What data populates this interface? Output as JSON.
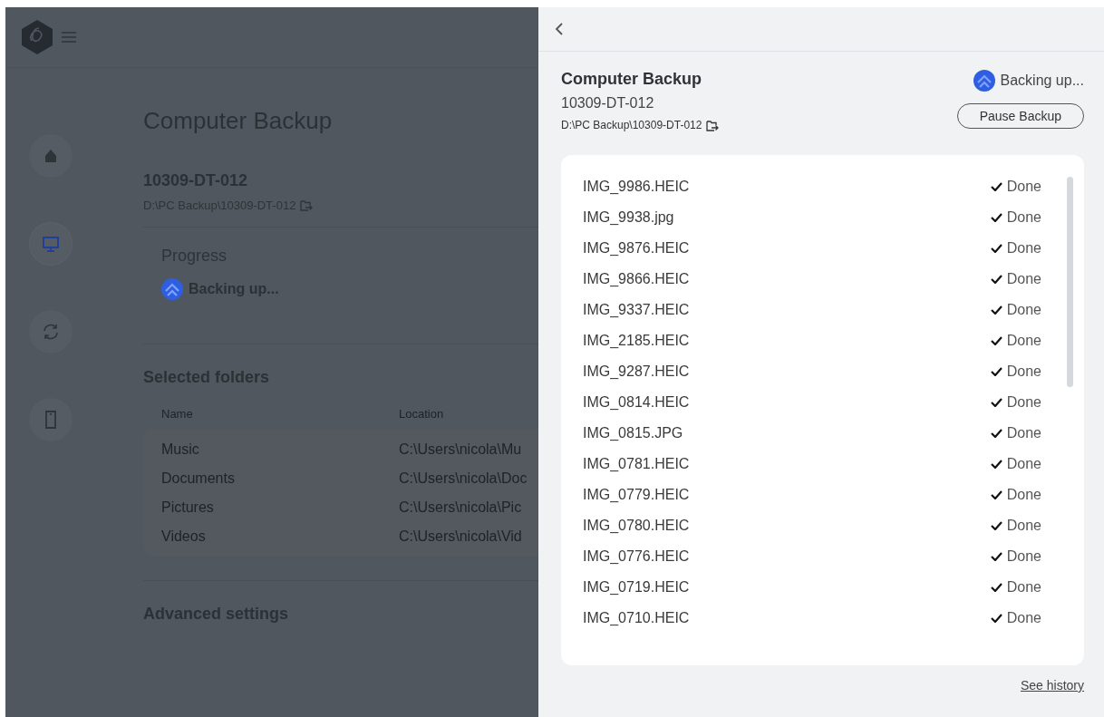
{
  "app": {
    "nav": [
      {
        "kind": "home",
        "selected": false
      },
      {
        "kind": "computer",
        "selected": true
      },
      {
        "kind": "sync",
        "selected": false
      },
      {
        "kind": "phone",
        "selected": false
      }
    ],
    "title": "Computer Backup",
    "device": "10309-DT-012",
    "path": "D:\\PC Backup\\10309-DT-012",
    "progress": {
      "heading": "Progress",
      "status": "Backing up..."
    },
    "folders": {
      "heading": "Selected folders",
      "columns": [
        "Name",
        "Location"
      ],
      "rows": [
        [
          "Music",
          "C:\\Users\\nicola\\Mu"
        ],
        [
          "Documents",
          "C:\\Users\\nicola\\Doc"
        ],
        [
          "Pictures",
          "C:\\Users\\nicola\\Pic"
        ],
        [
          "Videos",
          "C:\\Users\\nicola\\Vid"
        ]
      ]
    },
    "advanced": "Advanced settings"
  },
  "panel": {
    "title": "Computer Backup",
    "device": "10309-DT-012",
    "path": "D:\\PC Backup\\10309-DT-012",
    "status": "Backing up...",
    "pause_button": "Pause Backup",
    "files": [
      {
        "name": "IMG_9986.HEIC",
        "status": "Done",
        "done": true
      },
      {
        "name": "IMG_9938.jpg",
        "status": "Done",
        "done": true
      },
      {
        "name": "IMG_9876.HEIC",
        "status": "Done",
        "done": true
      },
      {
        "name": "IMG_9866.HEIC",
        "status": "Done",
        "done": true
      },
      {
        "name": "IMG_9337.HEIC",
        "status": "Done",
        "done": true
      },
      {
        "name": "IMG_2185.HEIC",
        "status": "Done",
        "done": true
      },
      {
        "name": "IMG_9287.HEIC",
        "status": "Done",
        "done": true
      },
      {
        "name": "IMG_0814.HEIC",
        "status": "Done",
        "done": true
      },
      {
        "name": "IMG_0815.JPG",
        "status": "Done",
        "done": true
      },
      {
        "name": "IMG_0781.HEIC",
        "status": "Done",
        "done": true
      },
      {
        "name": "IMG_0779.HEIC",
        "status": "Done",
        "done": true
      },
      {
        "name": "IMG_0780.HEIC",
        "status": "Done",
        "done": true
      },
      {
        "name": "IMG_0776.HEIC",
        "status": "Done",
        "done": true
      },
      {
        "name": "IMG_0719.HEIC",
        "status": "Done",
        "done": true
      },
      {
        "name": "IMG_0710.HEIC",
        "status": "Done",
        "done": true
      }
    ],
    "see_history": "See history"
  }
}
